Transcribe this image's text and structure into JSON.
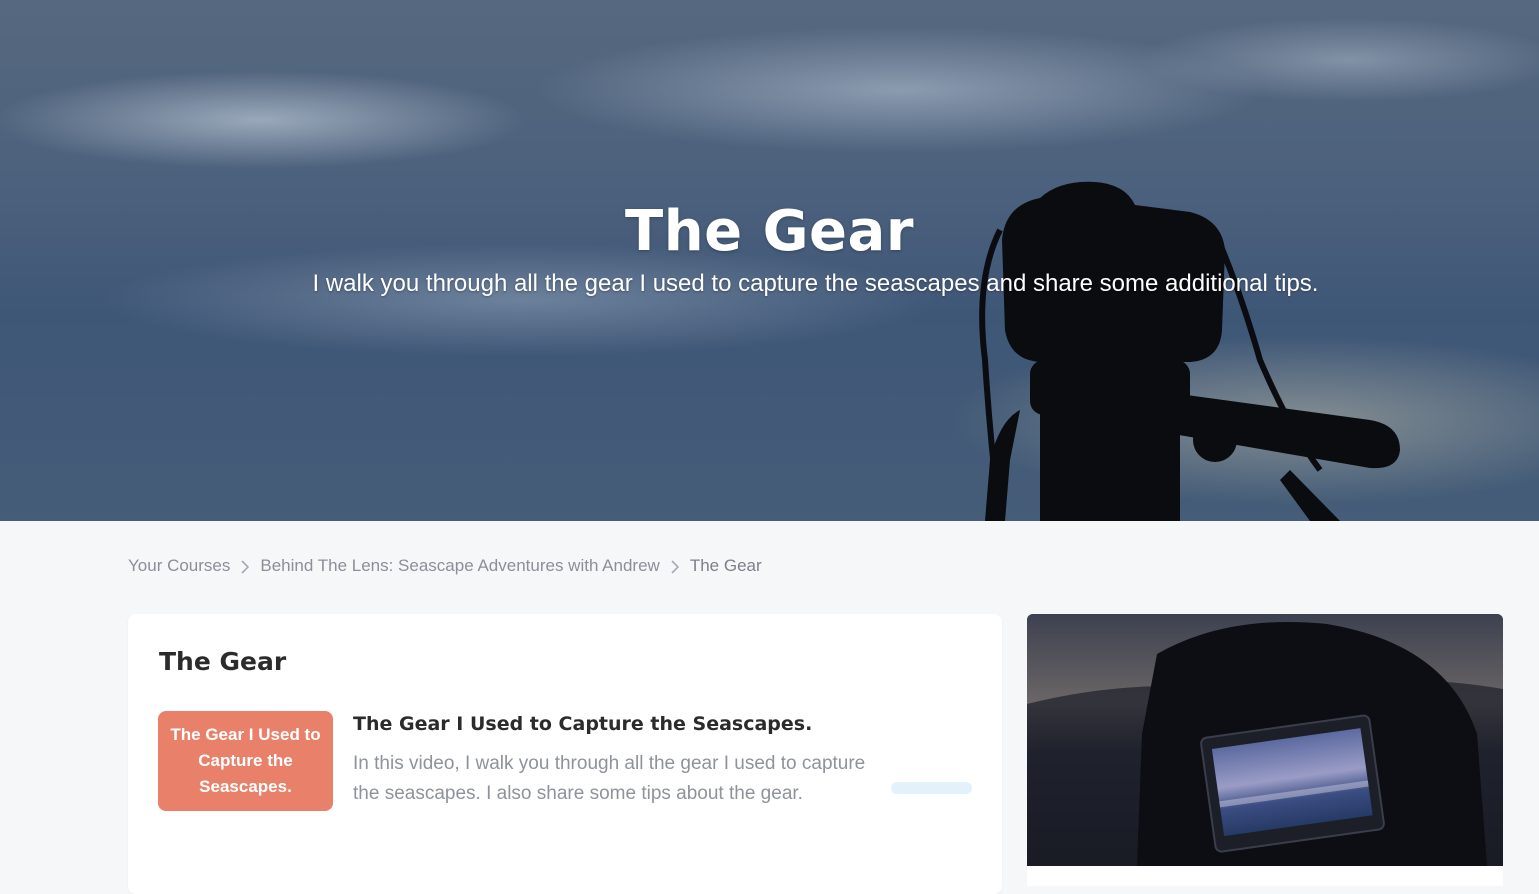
{
  "hero": {
    "title": "The Gear",
    "subtitle": "I walk you through all the gear I used to capture the seascapes and share some additional tips."
  },
  "breadcrumb": {
    "items": [
      "Your Courses",
      "Behind The Lens: Seascape Adventures with Andrew"
    ],
    "current": "The Gear"
  },
  "section": {
    "title": "The Gear"
  },
  "lessons": [
    {
      "thumb_text": "The Gear I Used to Capture the Seascapes.",
      "title": "The Gear I Used to Capture the Seascapes.",
      "description": "In this video, I walk you through all the gear I used to capture the seascapes. I also share some tips about the gear.",
      "progress": 0
    }
  ],
  "colors": {
    "page_bg": "#f6f7f9",
    "thumb_bg": "#e8806a",
    "progress_track": "#e3f1fa"
  }
}
